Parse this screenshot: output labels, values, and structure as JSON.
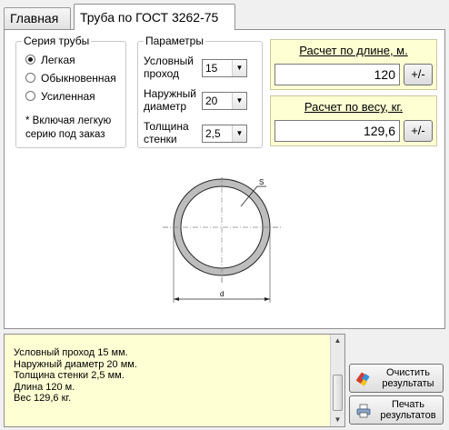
{
  "tabs": [
    {
      "label": "Главная"
    },
    {
      "label": "Труба по ГОСТ 3262-75"
    }
  ],
  "series_group": {
    "title": "Серия трубы",
    "options": [
      {
        "label": "Легкая",
        "checked": true
      },
      {
        "label": "Обыкновенная",
        "checked": false
      },
      {
        "label": "Усиленная",
        "checked": false
      }
    ],
    "note": "* Включая легкую серию под заказ"
  },
  "params_group": {
    "title": "Параметры",
    "nominal_bore": {
      "label": "Условный проход",
      "value": "15"
    },
    "outer_diameter": {
      "label": "Наружный диаметр",
      "value": "20"
    },
    "wall_thickness": {
      "label": "Толщина стенки",
      "value": "2,5"
    }
  },
  "length_calc": {
    "title": "Расчет по длине, м.",
    "value": "120",
    "button": "+/-"
  },
  "weight_calc": {
    "title": "Расчет по весу, кг.",
    "value": "129,6",
    "button": "+/-"
  },
  "diagram": {
    "thickness_label": "S",
    "diameter_label": "d"
  },
  "results": {
    "lines": [
      "Условный проход 15 мм.",
      "Наружный диаметр 20 мм.",
      "Толщина стенки 2,5 мм.",
      "Длина 120 м.",
      "Вес 129,6 кг."
    ]
  },
  "buttons": {
    "clear": "Очистить результаты",
    "print": "Печать результатов"
  }
}
